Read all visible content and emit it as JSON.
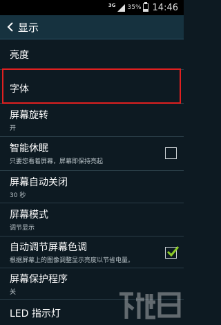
{
  "status": {
    "network": "3G",
    "battery_pct": "35%",
    "battery_level": 0.35,
    "time": "14:46"
  },
  "header": {
    "title": "显示"
  },
  "items": [
    {
      "label": "亮度",
      "sub": ""
    },
    {
      "label": "字体",
      "sub": ""
    },
    {
      "label": "屏幕旋转",
      "sub": "开"
    },
    {
      "label": "智能休眠",
      "sub": "只要您看着屏幕，屏幕即保持亮起",
      "checked": false
    },
    {
      "label": "屏幕自动关闭",
      "sub": "30 秒"
    },
    {
      "label": "屏幕模式",
      "sub": "调节显示"
    },
    {
      "label": "自动调节屏幕色调",
      "sub": "根据屏幕上的图像调整显示亮度以节省电量。",
      "checked": true
    },
    {
      "label": "屏幕保护程序",
      "sub": "关"
    },
    {
      "label": "LED 指示灯",
      "sub": ""
    }
  ],
  "colors": {
    "accent": "#8ac926",
    "highlight": "#e02020",
    "header_bg": "#16323f",
    "bg": "#0d1a22"
  },
  "icons": {
    "back": "chevron-left-icon",
    "signal": "signal-icon",
    "battery": "battery-icon",
    "check": "checkmark-icon"
  }
}
